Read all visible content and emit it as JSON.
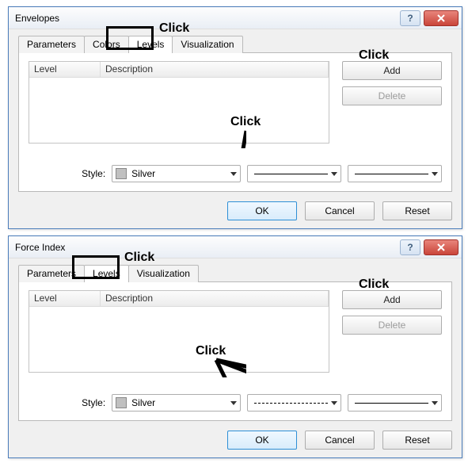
{
  "windows": {
    "envelopes": {
      "title": "Envelopes",
      "tabs": {
        "parameters": "Parameters",
        "colors": "Colors",
        "levels": "Levels",
        "visualization": "Visualization"
      },
      "active_tab": "levels",
      "list_headers": {
        "level": "Level",
        "description": "Description"
      },
      "buttons": {
        "add": "Add",
        "delete": "Delete"
      },
      "style": {
        "label": "Style:",
        "color_name": "Silver",
        "dash": "solid",
        "thickness": "solid"
      },
      "dialog_buttons": {
        "ok": "OK",
        "cancel": "Cancel",
        "reset": "Reset"
      }
    },
    "force_index": {
      "title": "Force Index",
      "tabs": {
        "parameters": "Parameters",
        "levels": "Levels",
        "visualization": "Visualization"
      },
      "active_tab": "levels",
      "list_headers": {
        "level": "Level",
        "description": "Description"
      },
      "buttons": {
        "add": "Add",
        "delete": "Delete"
      },
      "style": {
        "label": "Style:",
        "color_name": "Silver",
        "dash": "dashed",
        "thickness": "solid"
      },
      "dialog_buttons": {
        "ok": "OK",
        "cancel": "Cancel",
        "reset": "Reset"
      }
    }
  },
  "annotations": {
    "click": "Click"
  }
}
